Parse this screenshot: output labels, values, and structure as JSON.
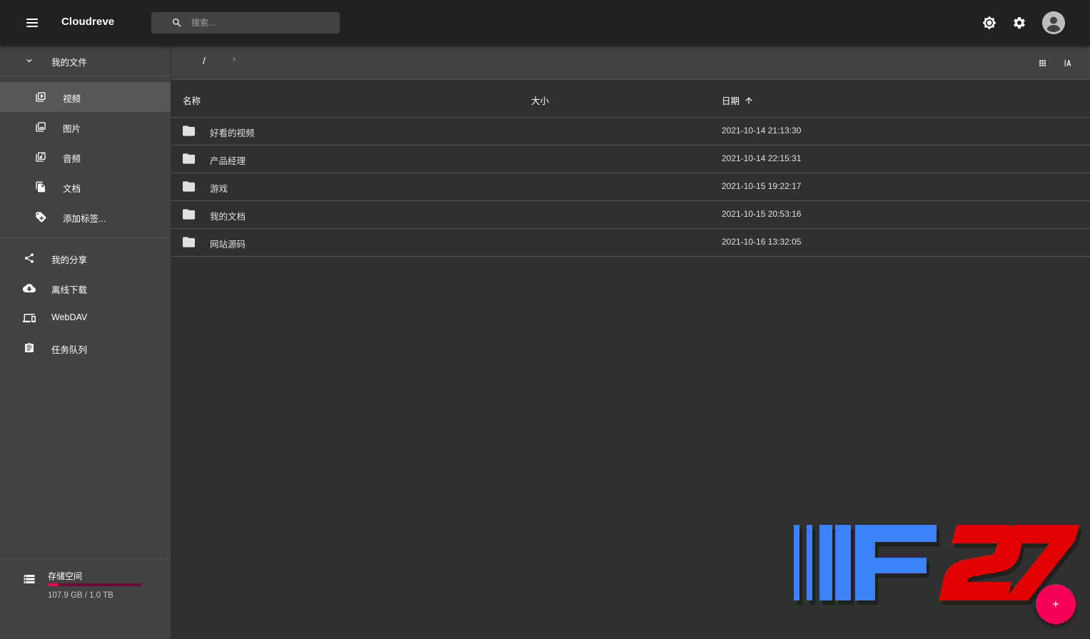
{
  "appbar": {
    "title": "Cloudreve",
    "search_placeholder": "搜索...",
    "icons": [
      "menu-icon",
      "search-icon",
      "brightness-icon",
      "settings-icon",
      "account-icon"
    ]
  },
  "sidebar": {
    "my_files": "我的文件",
    "categories": [
      {
        "label": "视频",
        "icon": "video-library-icon"
      },
      {
        "label": "图片",
        "icon": "photo-library-icon"
      },
      {
        "label": "音频",
        "icon": "music-library-icon"
      },
      {
        "label": "文档",
        "icon": "file-copy-icon"
      },
      {
        "label": "添加标签...",
        "icon": "tag-add-icon"
      }
    ],
    "links": [
      {
        "label": "我的分享",
        "icon": "share-icon"
      },
      {
        "label": "离线下载",
        "icon": "cloud-download-icon"
      },
      {
        "label": "WebDAV",
        "icon": "devices-icon"
      },
      {
        "label": "任务队列",
        "icon": "assignment-icon"
      }
    ],
    "storage": {
      "title": "存储空间",
      "usage": "107.9 GB / 1.0 TB",
      "used_fraction": 0.105
    }
  },
  "navigator": {
    "root": "/"
  },
  "table": {
    "headers": {
      "name": "名称",
      "size": "大小",
      "date": "日期"
    },
    "rows": [
      {
        "name": "好看的视频",
        "size": "",
        "date": "2021-10-14 21:13:30"
      },
      {
        "name": "产品经理",
        "size": "",
        "date": "2021-10-14 22:15:31"
      },
      {
        "name": "游戏",
        "size": "",
        "date": "2021-10-15 19:22:17"
      },
      {
        "name": "我的文档",
        "size": "",
        "date": "2021-10-15 20:53:16"
      },
      {
        "name": "网站源码",
        "size": "",
        "date": "2021-10-16 13:32:05"
      }
    ]
  },
  "colors": {
    "appbar": "#212121",
    "sidebar": "#424242",
    "background": "#303030",
    "accent": "#f50057"
  }
}
